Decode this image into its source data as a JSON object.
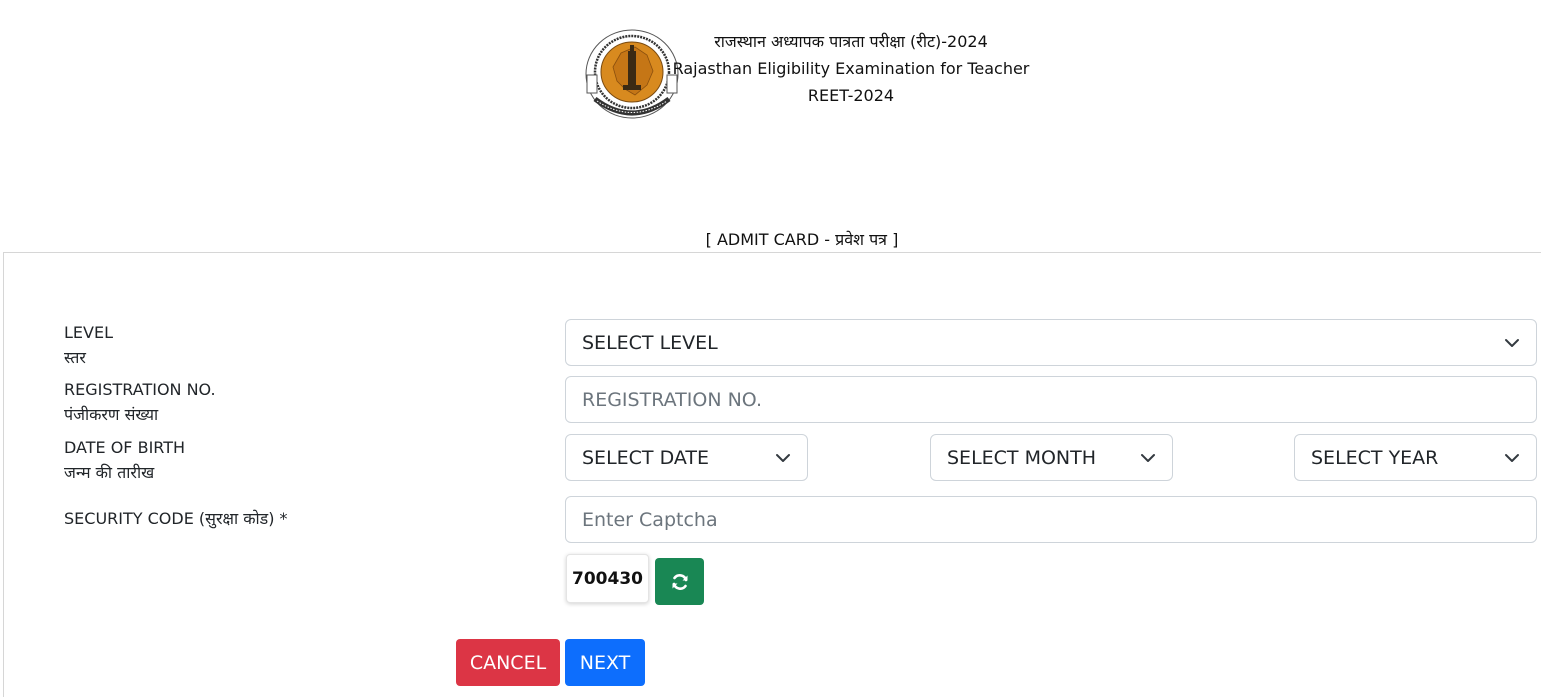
{
  "header": {
    "title_hindi": "राजस्थान अध्यापक पात्रता परीक्षा (रीट)-2024",
    "title_english": "Rajasthan Eligibility Examination for Teacher",
    "exam_code": "REET-2024",
    "logo_icon": "board-of-secondary-education-rajasthan-seal-icon"
  },
  "section_title": "[ ADMIT CARD - प्रवेश पत्र ]",
  "form": {
    "level": {
      "label_en": "LEVEL",
      "label_hi": "स्तर",
      "selected": "SELECT LEVEL"
    },
    "registration": {
      "label_en": "REGISTRATION NO.",
      "label_hi": "पंजीकरण संख्या",
      "value": "",
      "placeholder": "REGISTRATION NO."
    },
    "dob": {
      "label_en": "DATE OF BIRTH",
      "label_hi": "जन्म की तारीख",
      "date_selected": "SELECT DATE",
      "month_selected": "SELECT MONTH",
      "year_selected": "SELECT YEAR"
    },
    "security": {
      "label": "SECURITY CODE (सुरक्षा कोड) *",
      "value": "",
      "placeholder": "Enter Captcha",
      "captcha_code": "700430",
      "refresh_icon": "refresh-icon"
    }
  },
  "buttons": {
    "cancel": "CANCEL",
    "next": "NEXT"
  },
  "colors": {
    "cancel": "#dc3545",
    "next": "#0d6efd",
    "refresh": "#198754",
    "border": "#ced4da"
  }
}
